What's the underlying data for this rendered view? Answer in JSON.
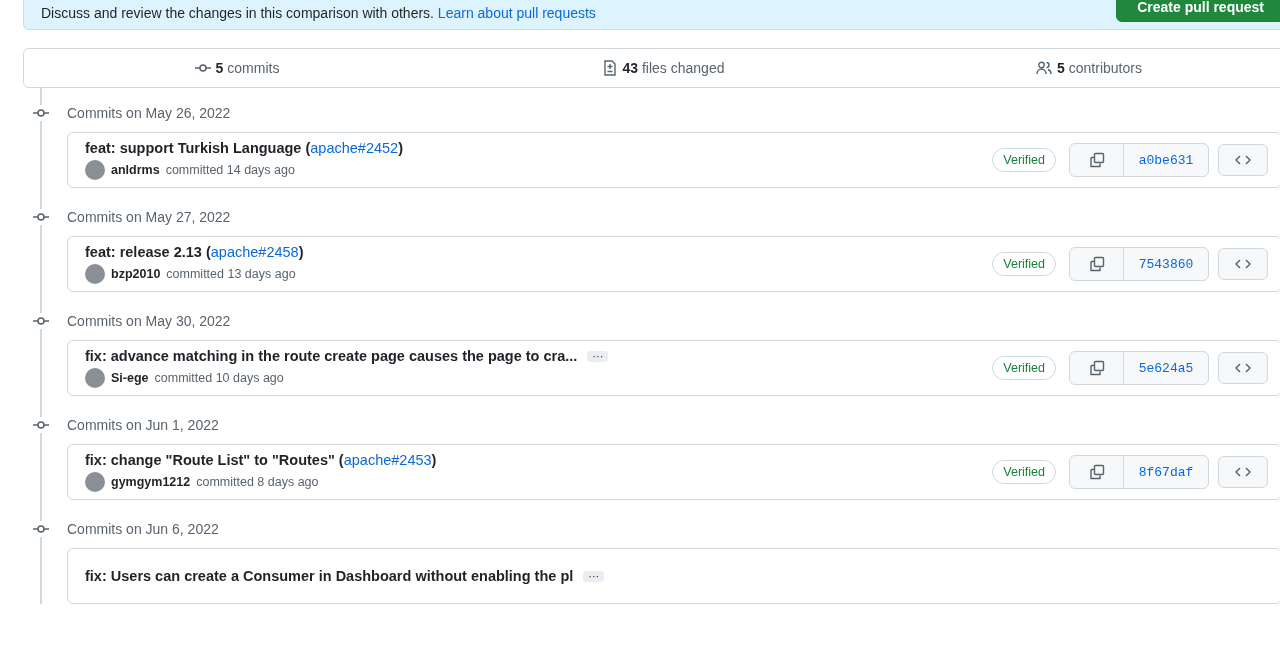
{
  "banner": {
    "text": "Discuss and review the changes in this comparison with others.",
    "link": "Learn about pull requests",
    "button": "Create pull request"
  },
  "stats": [
    {
      "kind": "commits",
      "count": "5",
      "label": "commits"
    },
    {
      "kind": "files",
      "count": "43",
      "label": "files changed"
    },
    {
      "kind": "contributors",
      "count": "5",
      "label": "contributors"
    }
  ],
  "groups": [
    {
      "date": "Commits on May 26, 2022",
      "commits": [
        {
          "title": "feat: support Turkish Language (",
          "issue": "apache#2452",
          "title_end": ")",
          "author": "anldrms",
          "when": "committed 14 days ago",
          "badge": "Verified",
          "sha": "a0be631"
        }
      ]
    },
    {
      "date": "Commits on May 27, 2022",
      "commits": [
        {
          "title": "feat: release 2.13 (",
          "issue": "apache#2458",
          "title_end": ")",
          "author": "bzp2010",
          "when": "committed 13 days ago",
          "badge": "Verified",
          "sha": "7543860"
        }
      ]
    },
    {
      "date": "Commits on May 30, 2022",
      "commits": [
        {
          "title": "fix: advance matching in the route create page causes the page to cra...",
          "expand": "···",
          "author": "Si-ege",
          "when": "committed 10 days ago",
          "badge": "Verified",
          "sha": "5e624a5"
        }
      ]
    },
    {
      "date": "Commits on Jun 1, 2022",
      "commits": [
        {
          "title": "fix: change \"Route List\" to \"Routes\" (",
          "issue": "apache#2453",
          "title_end": ")",
          "author": "gymgym1212",
          "when": "committed 8 days ago",
          "badge": "Verified",
          "sha": "8f67daf"
        }
      ]
    },
    {
      "date": "Commits on Jun 6, 2022",
      "commits": [
        {
          "title": "fix: Users can create a Consumer in Dashboard without enabling the pl",
          "expand": "···"
        }
      ]
    }
  ]
}
